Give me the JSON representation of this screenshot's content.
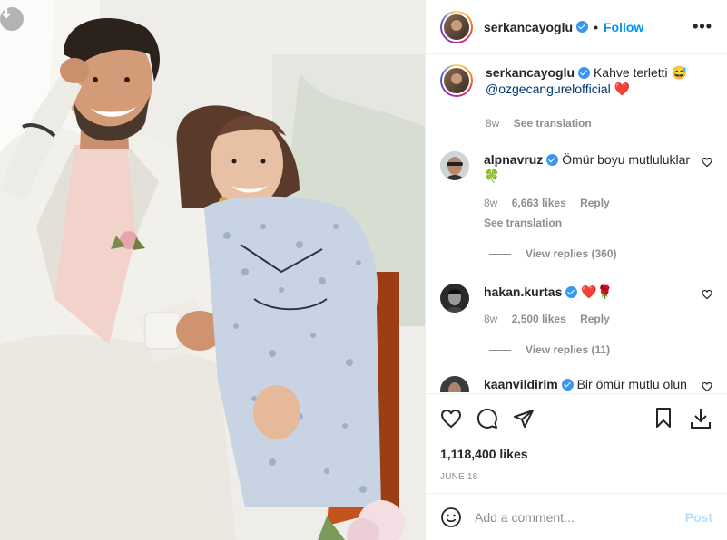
{
  "post": {
    "author": {
      "username": "serkancayoglu",
      "verified": true
    },
    "follow_label": "Follow",
    "more_label": "•••",
    "caption": {
      "text": "Kahve terletti",
      "emoji": "😅",
      "mention": "@ozgecangurelofficial",
      "emoji_after_mention": "❤️",
      "time": "8w",
      "see_translation": "See translation"
    },
    "comments": [
      {
        "username": "alpnavruz",
        "verified": true,
        "text": "Ömür boyu mutluluklar",
        "emoji": "🍀",
        "time": "8w",
        "likes": "6,663 likes",
        "reply": "Reply",
        "see_translation": "See translation",
        "view_replies": "View replies (360)"
      },
      {
        "username": "hakan.kurtas",
        "verified": true,
        "text": "",
        "emoji": "❤️🌹",
        "time": "8w",
        "likes": "2,500 likes",
        "reply": "Reply",
        "view_replies": "View replies (11)"
      },
      {
        "username": "kaanvildirim",
        "verified": true,
        "text": "Bir ömür mutlu olun",
        "emoji": ""
      }
    ],
    "likes_count": "1,118,400 likes",
    "date": "JUNE 18",
    "add_comment_placeholder": "Add a comment...",
    "post_label": "Post"
  },
  "icons": [
    "download-icon",
    "heart-icon",
    "comment-icon",
    "share-icon",
    "bookmark-icon",
    "emoji-icon",
    "verified-icon",
    "more-icon"
  ],
  "colors": {
    "link": "#0095f6",
    "mention": "#00376b",
    "verified": "#3897f0",
    "muted": "#8e8e8e",
    "post_disabled": "#b2dffc"
  }
}
